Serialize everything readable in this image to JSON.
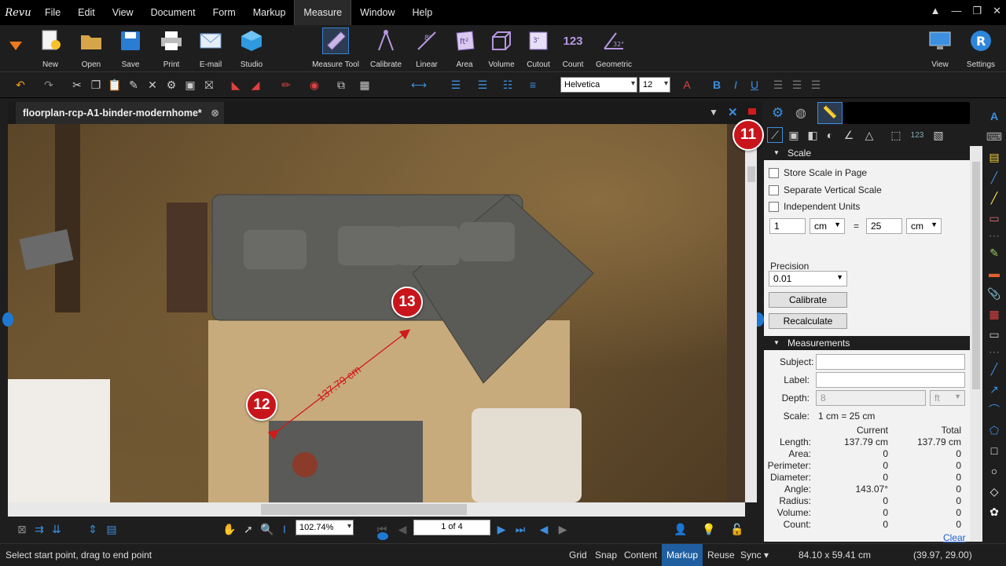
{
  "app": {
    "logo_text": "Revu"
  },
  "menu": [
    "File",
    "Edit",
    "View",
    "Document",
    "Form",
    "Markup",
    "Measure",
    "Window",
    "Help"
  ],
  "ribbon": {
    "left": [
      {
        "label": "New"
      },
      {
        "label": "Open"
      },
      {
        "label": "Save"
      },
      {
        "label": "Print"
      },
      {
        "label": "E-mail"
      },
      {
        "label": "Studio"
      }
    ],
    "measure": [
      {
        "label": "Measure Tool"
      },
      {
        "label": "Calibrate"
      },
      {
        "label": "Linear"
      },
      {
        "label": "Area"
      },
      {
        "label": "Volume"
      },
      {
        "label": "Cutout"
      },
      {
        "label": "Count"
      },
      {
        "label": "Geometric"
      }
    ],
    "right": [
      {
        "label": "View"
      },
      {
        "label": "Settings"
      }
    ],
    "count_glyph": "123"
  },
  "format": {
    "font": "Helvetica",
    "size": "12"
  },
  "document": {
    "tab_title": "floorplan-rcp-A1-binder-modernhome*",
    "measurement_label": "137.79 cm"
  },
  "nav": {
    "zoom": "102.74%",
    "page": "1 of 4"
  },
  "badges": {
    "b11": "11",
    "b12": "12",
    "b13": "13"
  },
  "panel": {
    "scale_header": "Scale",
    "checkboxes": [
      "Store Scale in Page",
      "Separate Vertical Scale",
      "Independent Units"
    ],
    "scale_left_value": "1",
    "scale_left_unit": "cm",
    "equals": "=",
    "scale_right_value": "25",
    "scale_right_unit": "cm",
    "precision_label": "Precision",
    "precision_value": "0.01",
    "calibrate_btn": "Calibrate",
    "recalculate_btn": "Recalculate",
    "measurements_header": "Measurements",
    "subject_label": "Subject:",
    "label_label": "Label:",
    "depth_label": "Depth:",
    "depth_value": "8",
    "depth_unit": "ft",
    "scale_label": "Scale:",
    "scale_value": "1 cm = 25 cm",
    "col_current": "Current",
    "col_total": "Total",
    "rows": [
      {
        "name": "Length:",
        "current": "137.79 cm",
        "total": "137.79 cm"
      },
      {
        "name": "Area:",
        "current": "0",
        "total": "0"
      },
      {
        "name": "Perimeter:",
        "current": "0",
        "total": "0"
      },
      {
        "name": "Diameter:",
        "current": "0",
        "total": "0"
      },
      {
        "name": "Angle:",
        "current": "143.07°",
        "total": "0"
      },
      {
        "name": "Radius:",
        "current": "0",
        "total": "0"
      },
      {
        "name": "Volume:",
        "current": "0",
        "total": "0"
      },
      {
        "name": "Count:",
        "current": "0",
        "total": "0"
      }
    ],
    "clear_link": "Clear"
  },
  "status": {
    "hint": "Select start point, drag to end point",
    "toggles": [
      "Grid",
      "Snap",
      "Content",
      "Markup",
      "Reuse",
      "Sync"
    ],
    "active_toggle": "Markup",
    "page_size": "84.10 x 59.41 cm",
    "coords": "(39.97, 29.00)"
  },
  "colors": {
    "accent": "#1f5fa0",
    "badge": "#c8151b",
    "measure_line": "#d11a1a"
  }
}
